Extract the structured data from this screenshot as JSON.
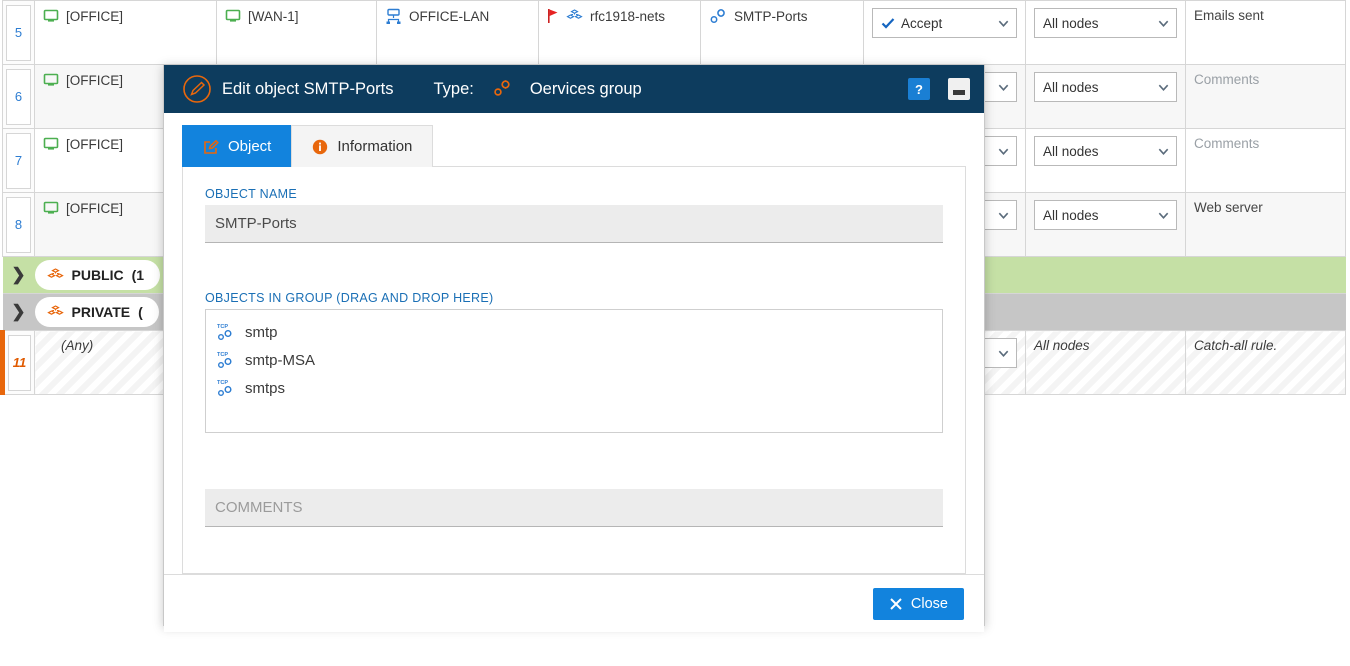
{
  "table": {
    "columns": [
      "num",
      "source",
      "destination",
      "interface",
      "network",
      "service",
      "action",
      "node",
      "comment"
    ],
    "rows": [
      {
        "num": "5",
        "source": {
          "icon": "monitor-icon",
          "label": "[OFFICE]"
        },
        "destination": {
          "icon": "monitor-icon",
          "label": "[WAN-1]"
        },
        "interface": {
          "icon": "network-hub-icon",
          "label": "OFFICE-LAN"
        },
        "network": {
          "icon": "group-cubes-icon",
          "negated": true,
          "label": "rfc1918-nets"
        },
        "service": {
          "icon": "service-group-icon",
          "label": "SMTP-Ports"
        },
        "action": {
          "icon": "check-icon",
          "label": "Accept"
        },
        "node": {
          "label": "All nodes"
        },
        "comment": {
          "label": "Emails sent",
          "is_placeholder": false
        }
      },
      {
        "num": "6",
        "source": {
          "icon": "monitor-icon",
          "label": "[OFFICE]"
        },
        "node": {
          "label": "All nodes"
        },
        "comment": {
          "label": "Comments",
          "is_placeholder": true
        }
      },
      {
        "num": "7",
        "source": {
          "icon": "monitor-icon",
          "label": "[OFFICE]"
        },
        "node": {
          "label": "All nodes"
        },
        "comment": {
          "label": "Comments",
          "is_placeholder": true
        }
      },
      {
        "num": "8",
        "source": {
          "icon": "monitor-icon",
          "label": "[OFFICE]"
        },
        "node": {
          "label": "All nodes"
        },
        "comment": {
          "label": "Web server",
          "is_placeholder": false
        }
      }
    ],
    "groups": [
      {
        "name": "PUBLIC",
        "count": "(1",
        "icon": "group-cubes-icon",
        "expander": "chevron-right-icon",
        "color": "#c5e0a5"
      },
      {
        "name": "PRIVATE",
        "count": "(",
        "icon": "group-cubes-icon",
        "expander": "chevron-right-icon",
        "color": "#c6c6c6"
      }
    ],
    "catch_all": {
      "num": "11",
      "source": "(Any)",
      "node": "All nodes",
      "comment": "Catch-all rule."
    }
  },
  "dialog": {
    "title": "Edit object SMTP-Ports",
    "edit_icon": "pencil-circle-icon",
    "type_label": "Type:",
    "type_icon": "service-group-icon",
    "type_name": "Oervices group",
    "help_button": "?",
    "minimize_button": "minimize-icon",
    "tabs": [
      {
        "label": "Object",
        "icon": "edit-square-icon",
        "active": true
      },
      {
        "label": "Information",
        "icon": "info-circle-icon",
        "active": false
      }
    ],
    "object_name": {
      "label": "OBJECT NAME",
      "value": "SMTP-Ports"
    },
    "objects_in_group": {
      "label": "OBJECTS IN GROUP (DRAG AND DROP HERE)",
      "items": [
        {
          "icon": "tcp-service-icon",
          "label": "smtp"
        },
        {
          "icon": "tcp-service-icon",
          "label": "smtp-MSA"
        },
        {
          "icon": "tcp-service-icon",
          "label": "smtps"
        }
      ]
    },
    "comments": {
      "label": "COMMENTS",
      "value": "",
      "placeholder": "COMMENTS"
    },
    "footer": {
      "close_label": "Close",
      "close_icon": "close-x-icon"
    }
  },
  "colors": {
    "title_bar": "#0d3c5e",
    "accent_blue": "#1283dd",
    "orange": "#e8670c",
    "group_public": "#c5e0a5",
    "group_private": "#c6c6c6",
    "label_blue": "#1a6fb5"
  }
}
